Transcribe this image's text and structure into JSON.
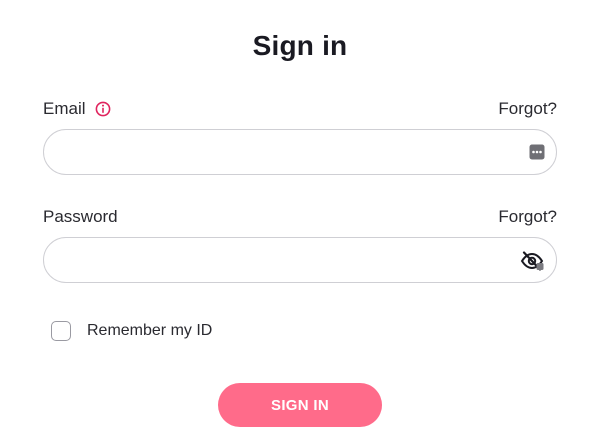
{
  "page": {
    "title": "Sign in"
  },
  "email": {
    "label": "Email",
    "forgot_label": "Forgot?",
    "value": "",
    "placeholder": "",
    "icon": "info-icon",
    "field_icon": "password-manager-icon"
  },
  "password": {
    "label": "Password",
    "forgot_label": "Forgot?",
    "value": "",
    "placeholder": "",
    "field_icon": "eye-slash-icon"
  },
  "remember": {
    "label": "Remember my ID",
    "checked": false
  },
  "submit": {
    "label": "SIGN IN"
  },
  "colors": {
    "accent": "#ff6b8a",
    "info": "#e0245e",
    "border": "#cfcfd4",
    "text": "#2a2a30"
  }
}
